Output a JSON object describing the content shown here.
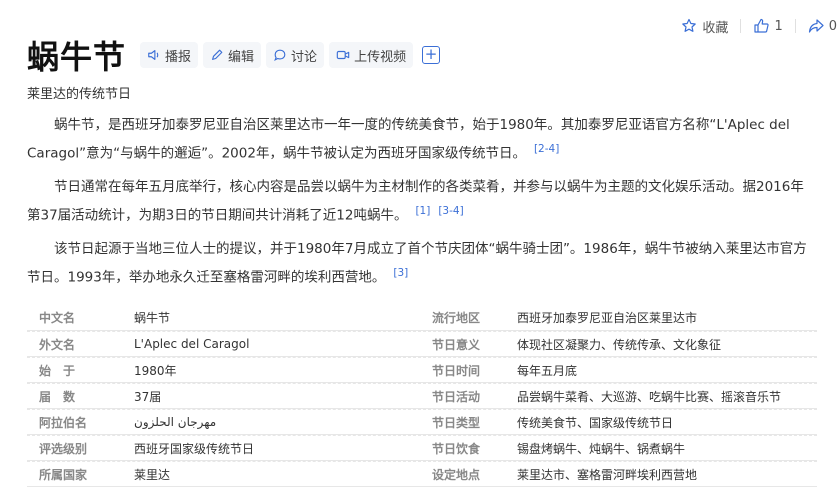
{
  "actions": {
    "favorite_label": "收藏",
    "like_count": "1",
    "share_count": "0"
  },
  "title": "蜗牛节",
  "toolbar": {
    "report_label": "播报",
    "edit_label": "编辑",
    "discuss_label": "讨论",
    "upload_video_label": "上传视频",
    "add_label": "+"
  },
  "subtitle": "莱里达的传统节日",
  "paragraphs": [
    {
      "text": "蜗牛节，是西班牙加泰罗尼亚自治区莱里达市一年一度的传统美食节，始于1980年。其加泰罗尼亚语官方名称“L'Aplec del Caragol”意为“与蜗牛的邂逅”。2002年，蜗牛节被认定为西班牙国家级传统节日。",
      "refs": [
        "[2-4]"
      ]
    },
    {
      "text": "节日通常在每年五月底举行，核心内容是品尝以蜗牛为主材制作的各类菜肴，并参与以蜗牛为主题的文化娱乐活动。据2016年第37届活动统计，为期3日的节日期间共计消耗了近12吨蜗牛。",
      "refs": [
        "[1]",
        "[3-4]"
      ]
    },
    {
      "text": "该节日起源于当地三位人士的提议，并于1980年7月成立了首个节庆团体“蜗牛骑士团”。1986年，蜗牛节被纳入莱里达市官方节日。1993年，举办地永久迁至塞格雷河畔的埃利西营地。",
      "refs": [
        "[3]"
      ]
    }
  ],
  "infobox": [
    {
      "k1": "中文名",
      "v1": "蜗牛节",
      "k2": "流行地区",
      "v2": "西班牙加泰罗尼亚自治区莱里达市"
    },
    {
      "k1": "外文名",
      "v1": "L'Aplec del Caragol",
      "k2": "节日意义",
      "v2": "体现社区凝聚力、传统传承、文化象征"
    },
    {
      "k1": "始　于",
      "v1": "1980年",
      "k2": "节日时间",
      "v2": "每年五月底"
    },
    {
      "k1": "届　数",
      "v1": "37届",
      "k2": "节日活动",
      "v2": "品尝蜗牛菜肴、大巡游、吃蜗牛比赛、摇滚音乐节"
    },
    {
      "k1": "阿拉伯名",
      "v1": "مهرجان الحلزون",
      "k2": "节日类型",
      "v2": "传统美食节、国家级传统节日"
    },
    {
      "k1": "评选级别",
      "v1": "西班牙国家级传统节日",
      "k2": "节日饮食",
      "v2": "锡盘烤蜗牛、炖蜗牛、锅煮蜗牛"
    },
    {
      "k1": "所属国家",
      "v1": "莱里达",
      "k2": "设定地点",
      "v2": "莱里达市、塞格雷河畔埃利西营地"
    }
  ],
  "colors": {
    "link": "#3b6fd6",
    "label": "#888888"
  }
}
